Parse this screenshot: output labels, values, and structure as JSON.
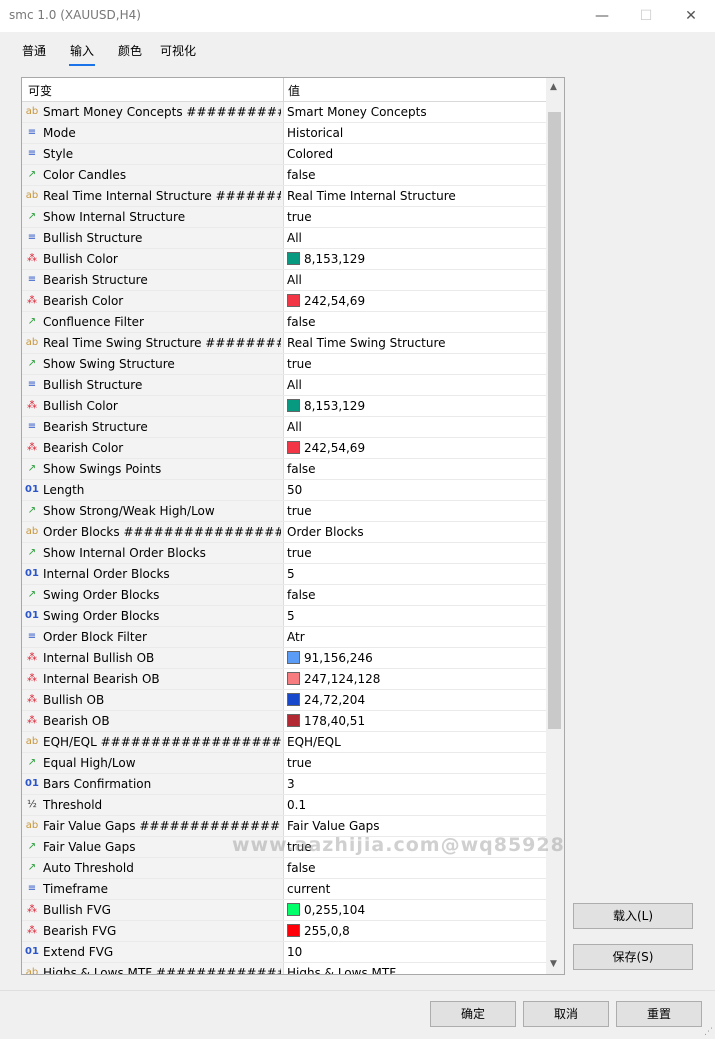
{
  "window": {
    "title": "smc 1.0 (XAUUSD,H4)",
    "minimize_glyph": "—",
    "maximize_glyph": "☐",
    "close_glyph": "✕"
  },
  "tabs": [
    {
      "label": "普通"
    },
    {
      "label": "输入"
    },
    {
      "label": "颜色"
    },
    {
      "label": "可视化"
    }
  ],
  "active_tab": "输入",
  "grid": {
    "col_variable": "可变",
    "col_value": "值",
    "rows": [
      {
        "icon": "ab",
        "name": "Smart Money Concepts ############...",
        "value": "Smart Money Concepts"
      },
      {
        "icon": "enum",
        "name": "Mode",
        "value": "Historical"
      },
      {
        "icon": "enum",
        "name": "Style",
        "value": "Colored"
      },
      {
        "icon": "bool",
        "name": "Color Candles",
        "value": "false"
      },
      {
        "icon": "ab",
        "name": "Real Time Internal Structure ########...",
        "value": "Real Time Internal Structure"
      },
      {
        "icon": "bool",
        "name": "Show Internal Structure",
        "value": "true"
      },
      {
        "icon": "enum",
        "name": "Bullish Structure",
        "value": "All"
      },
      {
        "icon": "color",
        "name": "Bullish Color",
        "value": "8,153,129",
        "swatch": "#089981"
      },
      {
        "icon": "enum",
        "name": "Bearish Structure",
        "value": "All"
      },
      {
        "icon": "color",
        "name": "Bearish Color",
        "value": "242,54,69",
        "swatch": "#f23645"
      },
      {
        "icon": "bool",
        "name": "Confluence Filter",
        "value": "false"
      },
      {
        "icon": "ab",
        "name": "Real Time Swing Structure ###########...",
        "value": "Real Time Swing Structure"
      },
      {
        "icon": "bool",
        "name": "Show Swing Structure",
        "value": "true"
      },
      {
        "icon": "enum",
        "name": "Bullish Structure",
        "value": "All"
      },
      {
        "icon": "color",
        "name": "Bullish Color",
        "value": "8,153,129",
        "swatch": "#089981"
      },
      {
        "icon": "enum",
        "name": "Bearish Structure",
        "value": "All"
      },
      {
        "icon": "color",
        "name": "Bearish Color",
        "value": "242,54,69",
        "swatch": "#f23645"
      },
      {
        "icon": "bool",
        "name": "Show Swings Points",
        "value": "false"
      },
      {
        "icon": "num",
        "name": "Length",
        "value": "50"
      },
      {
        "icon": "bool",
        "name": "Show Strong/Weak High/Low",
        "value": "true"
      },
      {
        "icon": "ab",
        "name": "Order Blocks ##################...",
        "value": "Order Blocks"
      },
      {
        "icon": "bool",
        "name": "Show Internal Order Blocks",
        "value": "true"
      },
      {
        "icon": "num",
        "name": "Internal Order Blocks",
        "value": "5"
      },
      {
        "icon": "bool",
        "name": "Swing Order Blocks",
        "value": "false"
      },
      {
        "icon": "num",
        "name": "Swing Order Blocks",
        "value": "5"
      },
      {
        "icon": "enum",
        "name": "Order Block Filter",
        "value": "Atr"
      },
      {
        "icon": "color",
        "name": "Internal Bullish OB",
        "value": "91,156,246",
        "swatch": "#5b9cf6"
      },
      {
        "icon": "color",
        "name": "Internal Bearish OB",
        "value": "247,124,128",
        "swatch": "#f77c80"
      },
      {
        "icon": "color",
        "name": "Bullish OB",
        "value": "24,72,204",
        "swatch": "#1848cc"
      },
      {
        "icon": "color",
        "name": "Bearish OB",
        "value": "178,40,51",
        "swatch": "#b22833"
      },
      {
        "icon": "ab",
        "name": "EQH/EQL #######################...",
        "value": "EQH/EQL"
      },
      {
        "icon": "bool",
        "name": "Equal High/Low",
        "value": "true"
      },
      {
        "icon": "num",
        "name": "Bars Confirmation",
        "value": "3"
      },
      {
        "icon": "half",
        "name": "Threshold",
        "value": "0.1"
      },
      {
        "icon": "ab",
        "name": "Fair Value Gaps #################...",
        "value": "Fair Value Gaps"
      },
      {
        "icon": "bool",
        "name": "Fair Value Gaps",
        "value": "true"
      },
      {
        "icon": "bool",
        "name": "Auto Threshold",
        "value": "false"
      },
      {
        "icon": "enum",
        "name": "Timeframe",
        "value": "current"
      },
      {
        "icon": "color",
        "name": "Bullish FVG",
        "value": "0,255,104",
        "swatch": "#00ff68"
      },
      {
        "icon": "color",
        "name": "Bearish FVG",
        "value": "255,0,8",
        "swatch": "#ff0008"
      },
      {
        "icon": "num",
        "name": "Extend FVG",
        "value": "10"
      },
      {
        "icon": "ab",
        "name": "Highs & Lows MTF ###############...",
        "value": "Highs & Lows MTF"
      }
    ]
  },
  "side_buttons": {
    "load": "载入(L)",
    "save": "保存(S)"
  },
  "footer": {
    "ok": "确定",
    "cancel": "取消",
    "reset": "重置"
  },
  "watermark": "www.aazhijia.com@wq85928",
  "icons": {
    "ab": "ab",
    "enum": "≡",
    "bool": "↗",
    "color": "⁂",
    "num": "01",
    "half": "½"
  }
}
